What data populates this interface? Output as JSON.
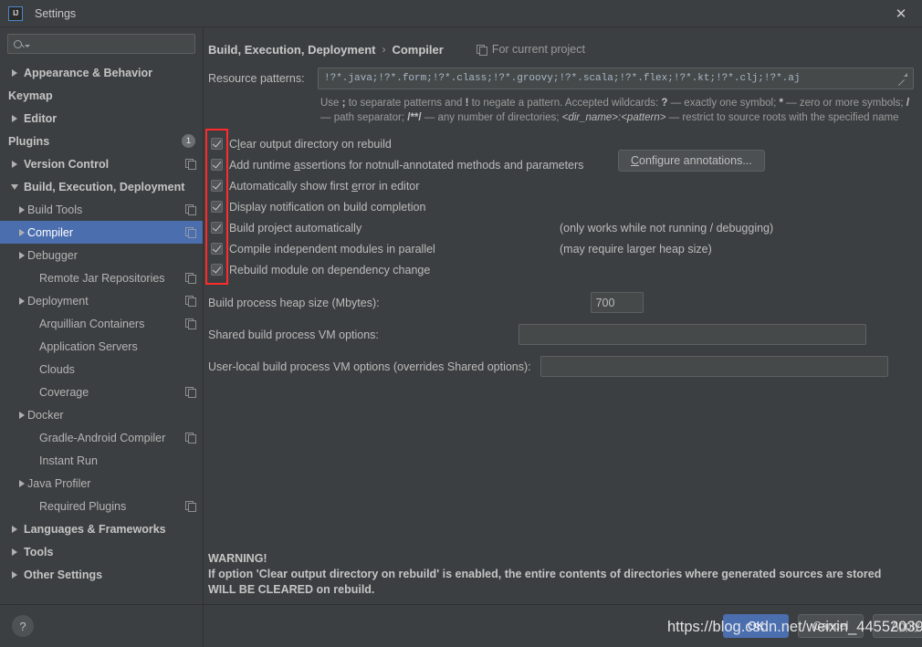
{
  "window": {
    "title": "Settings",
    "logo_text": "IJ",
    "close_label": "✕"
  },
  "sidebar": {
    "search_placeholder": "",
    "search_value": "",
    "search_icon": "search-icon",
    "items": [
      {
        "label": "Appearance & Behavior",
        "level": 0,
        "arrow": "right",
        "bold": true,
        "trailing": ""
      },
      {
        "label": "Keymap",
        "level": 0,
        "arrow": "none",
        "bold": true,
        "trailing": ""
      },
      {
        "label": "Editor",
        "level": 0,
        "arrow": "right",
        "bold": true,
        "trailing": ""
      },
      {
        "label": "Plugins",
        "level": 0,
        "arrow": "none",
        "bold": true,
        "trailing": "badge",
        "badge": "1"
      },
      {
        "label": "Version Control",
        "level": 0,
        "arrow": "right",
        "bold": true,
        "trailing": "copy"
      },
      {
        "label": "Build, Execution, Deployment",
        "level": 0,
        "arrow": "down",
        "bold": true,
        "trailing": ""
      },
      {
        "label": "Build Tools",
        "level": 1,
        "arrow": "right",
        "bold": false,
        "trailing": "copy"
      },
      {
        "label": "Compiler",
        "level": 1,
        "arrow": "right",
        "bold": false,
        "trailing": "copy",
        "selected": true
      },
      {
        "label": "Debugger",
        "level": 1,
        "arrow": "right",
        "bold": false,
        "trailing": ""
      },
      {
        "label": "Remote Jar Repositories",
        "level": 1,
        "arrow": "none",
        "bold": false,
        "trailing": "copy"
      },
      {
        "label": "Deployment",
        "level": 1,
        "arrow": "right",
        "bold": false,
        "trailing": "copy"
      },
      {
        "label": "Arquillian Containers",
        "level": 1,
        "arrow": "none",
        "bold": false,
        "trailing": "copy"
      },
      {
        "label": "Application Servers",
        "level": 1,
        "arrow": "none",
        "bold": false,
        "trailing": ""
      },
      {
        "label": "Clouds",
        "level": 1,
        "arrow": "none",
        "bold": false,
        "trailing": ""
      },
      {
        "label": "Coverage",
        "level": 1,
        "arrow": "none",
        "bold": false,
        "trailing": "copy"
      },
      {
        "label": "Docker",
        "level": 1,
        "arrow": "right",
        "bold": false,
        "trailing": ""
      },
      {
        "label": "Gradle-Android Compiler",
        "level": 1,
        "arrow": "none",
        "bold": false,
        "trailing": "copy"
      },
      {
        "label": "Instant Run",
        "level": 1,
        "arrow": "none",
        "bold": false,
        "trailing": ""
      },
      {
        "label": "Java Profiler",
        "level": 1,
        "arrow": "right",
        "bold": false,
        "trailing": ""
      },
      {
        "label": "Required Plugins",
        "level": 1,
        "arrow": "none",
        "bold": false,
        "trailing": "copy"
      },
      {
        "label": "Languages & Frameworks",
        "level": 0,
        "arrow": "right",
        "bold": true,
        "trailing": ""
      },
      {
        "label": "Tools",
        "level": 0,
        "arrow": "right",
        "bold": true,
        "trailing": ""
      },
      {
        "label": "Other Settings",
        "level": 0,
        "arrow": "right",
        "bold": true,
        "trailing": ""
      }
    ],
    "help_button_label": "?"
  },
  "main": {
    "breadcrumb_root": "Build, Execution, Deployment",
    "breadcrumb_separator": "›",
    "breadcrumb_leaf": "Compiler",
    "for_current_project": "For current project",
    "resource_patterns_label": "Resource patterns:",
    "resource_patterns_value": "!?*.java;!?*.form;!?*.class;!?*.groovy;!?*.scala;!?*.flex;!?*.kt;!?*.clj;!?*.aj",
    "resource_help": {
      "p1": "Use ",
      "b1": ";",
      "p2": " to separate patterns and ",
      "b2": "!",
      "p3": " to negate a pattern. Accepted wildcards: ",
      "b3": "?",
      "p4": " — exactly one symbol; ",
      "b4": "*",
      "p5": " — zero or more symbols; ",
      "b5": "/",
      "p6": " — path separator; ",
      "b6": "/**/",
      "p7": " — any number of directories; ",
      "i1": "<dir_name>:<pattern>",
      "p8": " — restrict to source roots with the specified name"
    },
    "options": [
      {
        "pre": "C",
        "mn": "l",
        "post": "ear output directory on rebuild",
        "checked": true,
        "hint": ""
      },
      {
        "pre": "Add runtime ",
        "mn": "a",
        "post": "ssertions for notnull-annotated methods and parameters",
        "checked": true,
        "hint": ""
      },
      {
        "pre": "Automatically show first ",
        "mn": "e",
        "post": "rror in editor",
        "checked": true,
        "hint": ""
      },
      {
        "pre": "Display notification on build completion",
        "mn": "",
        "post": "",
        "checked": true,
        "hint": ""
      },
      {
        "pre": "Build project automatically",
        "mn": "",
        "post": "",
        "checked": true,
        "hint": "(only works while not running / debugging)"
      },
      {
        "pre": "Compile independent modules in parallel",
        "mn": "",
        "post": "",
        "checked": true,
        "hint": "(may require larger heap size)"
      },
      {
        "pre": "Rebuild module on dependency change",
        "mn": "",
        "post": "",
        "checked": true,
        "hint": ""
      }
    ],
    "configure_annotations_pre": "C",
    "configure_annotations_mn": "",
    "configure_annotations_label": "Configure annotations...",
    "heap_label": "Build process heap size (Mbytes):",
    "heap_value": "700",
    "shared_vm_label": "Shared build process VM options:",
    "shared_vm_value": "",
    "userlocal_vm_label": "User-local build process VM options (overrides Shared options):",
    "userlocal_vm_value": "",
    "warning_title": "WARNING!",
    "warning_body": "If option 'Clear output directory on rebuild' is enabled, the entire contents of directories where generated sources are stored WILL BE CLEARED on rebuild."
  },
  "buttons": {
    "ok": "OK",
    "cancel": "Cancel",
    "apply": "Apply"
  },
  "annotation": {
    "watermark": "https://blog.csdn.net/weixin_44552039",
    "highlight_color": "#ff2b2b"
  }
}
